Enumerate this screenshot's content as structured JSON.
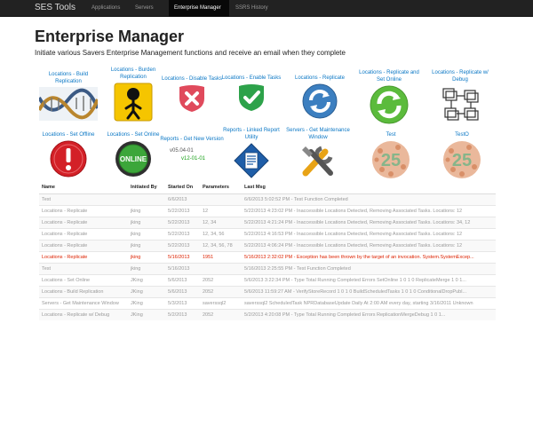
{
  "nav": {
    "brand": "SES Tools",
    "links": [
      "Applications",
      "Servers",
      "Enterprise Manager",
      "SSRS History"
    ]
  },
  "page": {
    "title": "Enterprise Manager",
    "subtitle": "Initiate various Savers Enterprise Management functions and receive an email when they complete"
  },
  "tiles": [
    {
      "label": "Locations - Build Replication",
      "icon": "dna-helix-icon"
    },
    {
      "label": "Locations - Burden Replication",
      "icon": "burden-figure-icon"
    },
    {
      "label": "Locations - Disable Tasks",
      "icon": "disable-x-icon"
    },
    {
      "label": "Locations - Enable Tasks",
      "icon": "enable-check-icon"
    },
    {
      "label": "Locations - Replicate",
      "icon": "refresh-arrows-icon"
    },
    {
      "label": "Locations - Replicate and Set Online",
      "icon": "green-refresh-icon"
    },
    {
      "label": "Locations - Replicate w/ Debug",
      "icon": "debug-boxes-icon"
    },
    {
      "label": "Locations - Set Offline",
      "icon": "offline-warning-icon"
    },
    {
      "label": "Locations - Set Online",
      "icon": "online-button-icon",
      "badge": "ONLINE"
    },
    {
      "label": "Reports - Get New Version",
      "icon": "version-text-icon",
      "versions": [
        "v05.04-01",
        "v12-01-01"
      ]
    },
    {
      "label": "Reports - Linked Report Utility",
      "icon": "report-document-icon"
    },
    {
      "label": "Servers - Get Maintenance Window",
      "icon": "tools-icon"
    },
    {
      "label": "Test",
      "icon": "color-test-25-icon",
      "number": "25"
    },
    {
      "label": "TestO",
      "icon": "color-test-25-icon",
      "number": "25"
    }
  ],
  "table": {
    "headers": [
      "Name",
      "Initiated By",
      "Started On",
      "Parameters",
      "Last Msg"
    ],
    "rows": [
      {
        "name": "Test",
        "by": "",
        "on": "6/6/2013",
        "params": "",
        "msg": "6/6/2013 5:02:52 PM - Test Function Completed",
        "error": false
      },
      {
        "name": "Locations - Replicate",
        "by": "jking",
        "on": "5/22/2013",
        "params": "12",
        "msg": "5/22/2013 4:23:02 PM - Inaccessible Locations Detected, Removing Associated Tasks. Locations: 12",
        "error": false
      },
      {
        "name": "Locations - Replicate",
        "by": "jking",
        "on": "5/22/2013",
        "params": "12, 34",
        "msg": "5/22/2013 4:21:24 PM - Inaccessible Locations Detected, Removing Associated Tasks. Locations: 34, 12",
        "error": false
      },
      {
        "name": "Locations - Replicate",
        "by": "jking",
        "on": "5/22/2013",
        "params": "12, 34, 56",
        "msg": "5/22/2013 4:16:53 PM - Inaccessible Locations Detected, Removing Associated Tasks. Locations: 12",
        "error": false
      },
      {
        "name": "Locations - Replicate",
        "by": "jking",
        "on": "5/22/2013",
        "params": "12, 34, 56, 78",
        "msg": "5/22/2013 4:06:24 PM - Inaccessible Locations Detected, Removing Associated Tasks. Locations: 12",
        "error": false
      },
      {
        "name": "Locations - Replicate",
        "by": "jking",
        "on": "5/16/2013",
        "params": "1951",
        "msg": "5/16/2013 2:32:02 PM - Exception has been thrown by the target of an invocation. System.SystemExcep...",
        "error": true
      },
      {
        "name": "Test",
        "by": "jking",
        "on": "5/16/2013",
        "params": "",
        "msg": "5/16/2013 2:25:55 PM - Test Function Completed",
        "error": false
      },
      {
        "name": "Locations - Set Online",
        "by": "JKing",
        "on": "5/6/2013",
        "params": "2052",
        "msg": "5/6/2013 3:22:34 PM - Type Total Running Completed Errors SetOnline 1 0 1 0 ReplicateMerge 1 0 1...",
        "error": false
      },
      {
        "name": "Locations - Build Replication",
        "by": "JKing",
        "on": "5/6/2013",
        "params": "2052",
        "msg": "5/6/2013 11:59:27 AM - VerifyStoreRecord 1 0 1 0 BuildScheduledTasks 1 0 1 0 ConditionalDropPubl...",
        "error": false
      },
      {
        "name": "Servers - Get Maintenance Window",
        "by": "JKing",
        "on": "5/3/2013",
        "params": "saverssql2",
        "msg": "saverssql2 ScheduledTask NPRDatabaseUpdate Daily At 2:00 AM every day, starting 3/16/2011 Unknown",
        "error": false
      },
      {
        "name": "Locations - Replicate w/ Debug",
        "by": "JKing",
        "on": "5/2/2013",
        "params": "2052",
        "msg": "5/2/2013 4:20:08 PM - Type Total Running Completed Errors ReplicationMergeDebug 1 0 1...",
        "error": false
      }
    ]
  }
}
